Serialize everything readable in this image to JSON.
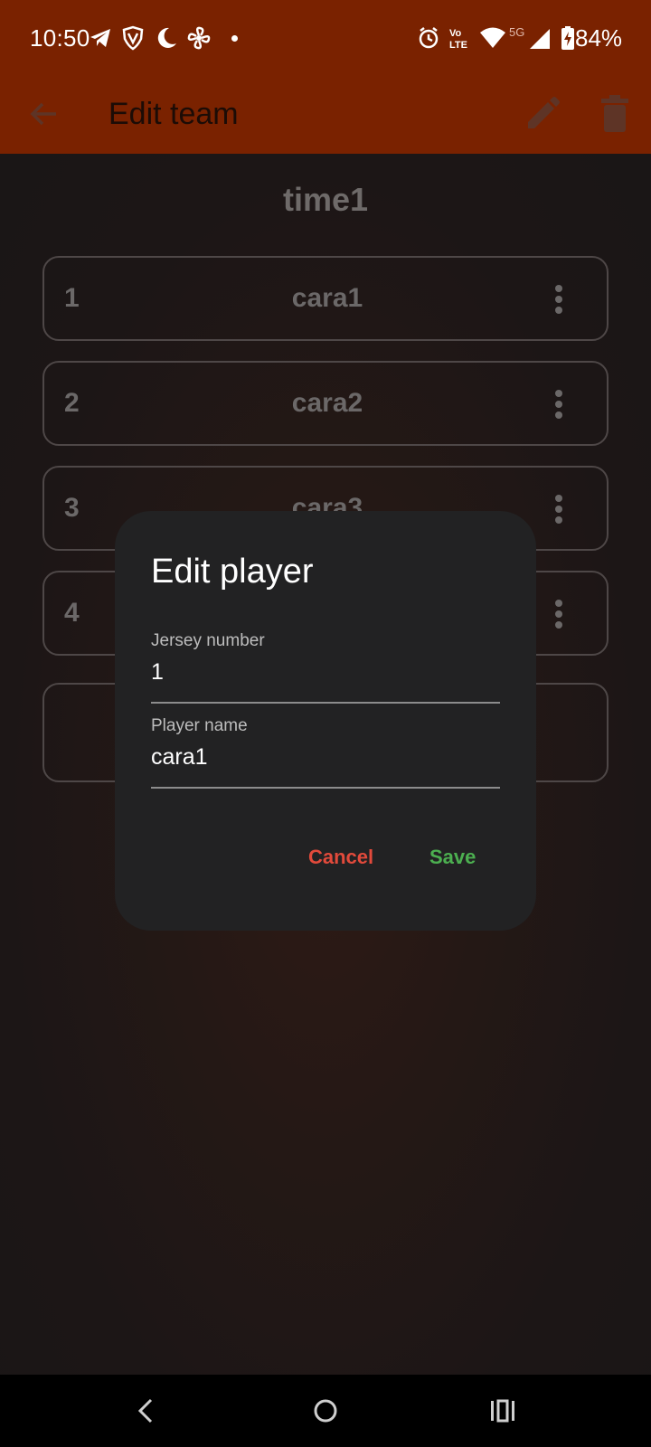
{
  "status_bar": {
    "time": "10:50",
    "battery": "84%",
    "network": "5G",
    "icons": [
      "telegram-icon",
      "vpn-shield-icon",
      "moon-icon",
      "fan-icon",
      "alarm-icon",
      "volte-icon",
      "wifi-icon",
      "signal-icon",
      "battery-charging-icon"
    ]
  },
  "app_bar": {
    "title": "Edit team",
    "icons": [
      "back-arrow-icon",
      "edit-pencil-icon",
      "delete-trash-icon"
    ]
  },
  "team": {
    "name": "time1",
    "players": [
      {
        "number": "1",
        "name": "cara1"
      },
      {
        "number": "2",
        "name": "cara2"
      },
      {
        "number": "3",
        "name": "cara3"
      },
      {
        "number": "4",
        "name": ""
      }
    ]
  },
  "dialog": {
    "title": "Edit player",
    "jersey_label": "Jersey number",
    "jersey_value": "1",
    "name_label": "Player name",
    "name_value": "cara1",
    "cancel_label": "Cancel",
    "save_label": "Save"
  },
  "colors": {
    "app_bar": "#7a2200",
    "cancel": "#e24a3b",
    "save": "#4caf50",
    "dialog_bg": "#222223"
  },
  "nav_bar": {
    "icons": [
      "back-chevron-icon",
      "home-circle-icon",
      "recents-icon"
    ]
  }
}
